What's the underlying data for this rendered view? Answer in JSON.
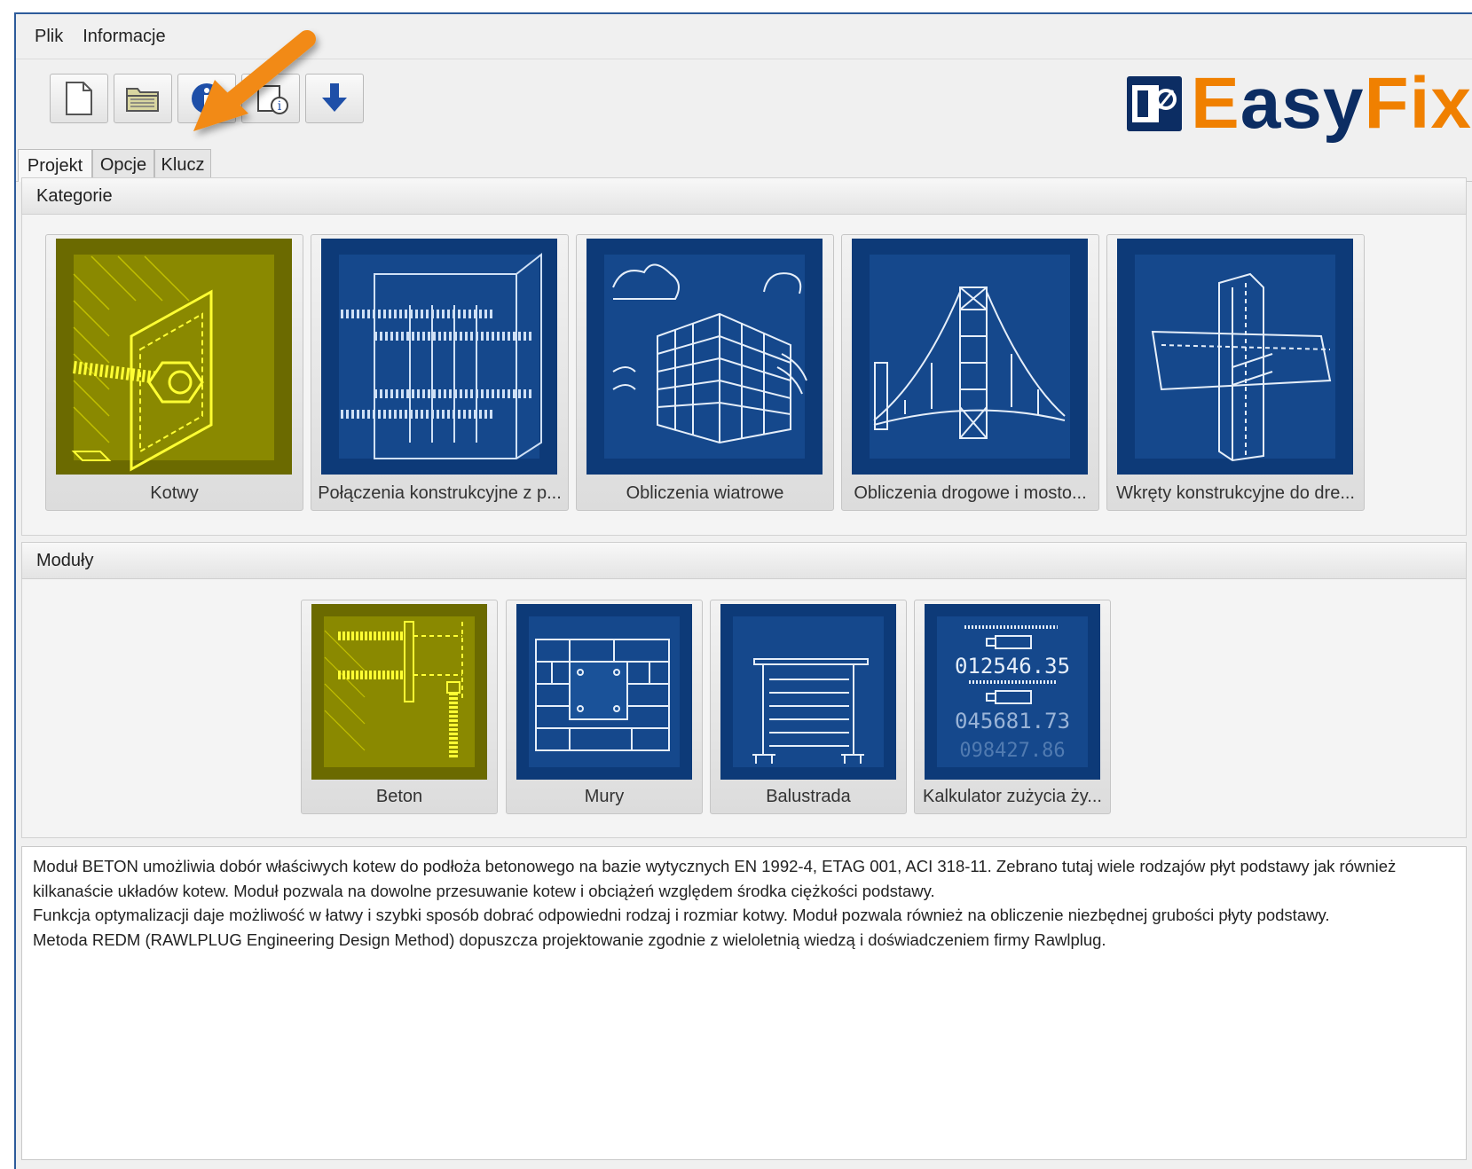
{
  "menu": {
    "file": "Plik",
    "info": "Informacje"
  },
  "toolbar": {
    "buttons": [
      {
        "icon": "new-document-icon"
      },
      {
        "icon": "open-folder-icon"
      },
      {
        "icon": "info-icon"
      },
      {
        "icon": "about-icon"
      },
      {
        "icon": "download-icon"
      }
    ]
  },
  "logo": {
    "part1": "E",
    "part2": "asy",
    "part3": "Fix"
  },
  "tabs": [
    "Projekt",
    "Opcje",
    "Klucz"
  ],
  "categories": {
    "title": "Kategorie",
    "items": [
      {
        "label": "Kotwy",
        "selected": true
      },
      {
        "label": "Połączenia konstrukcyjne z p...",
        "selected": false
      },
      {
        "label": "Obliczenia wiatrowe",
        "selected": false
      },
      {
        "label": "Obliczenia drogowe i mosto...",
        "selected": false
      },
      {
        "label": "Wkręty konstrukcyjne do dre...",
        "selected": false
      }
    ]
  },
  "modules": {
    "title": "Moduły",
    "items": [
      {
        "label": "Beton",
        "selected": true
      },
      {
        "label": "Mury",
        "selected": false
      },
      {
        "label": "Balustrada",
        "selected": false
      },
      {
        "label": "Kalkulator zużycia ży...",
        "selected": false
      }
    ],
    "calc_digits": [
      "012546.35",
      "045681.73",
      "098427.86"
    ]
  },
  "description": [
    "Moduł BETON umożliwia dobór właściwych kotew do podłoża betonowego na bazie wytycznych EN 1992-4, ETAG 001, ACI 318-11. Zebrano tutaj wiele rodzajów płyt podstawy jak również kilkanaście układów kotew. Moduł pozwala na dowolne przesuwanie kotew i obciążeń względem środka ciężkości podstawy.",
    "Funkcja optymalizacji daje możliwość w łatwy i szybki sposób dobrać odpowiedni rodzaj i rozmiar kotwy. Moduł pozwala również na obliczenie niezbędnej grubości płyty podstawy.",
    "Metoda REDM (RAWLPLUG Engineering Design Method) dopuszcza projektowanie zgodnie z wieloletnią wiedzą i doświadczeniem firmy Rawlplug."
  ],
  "colors": {
    "accent_orange": "#f08000",
    "brand_navy": "#0c2d63",
    "tile_blue": "#0d3a78",
    "tile_yellow": "#6b6a00"
  }
}
